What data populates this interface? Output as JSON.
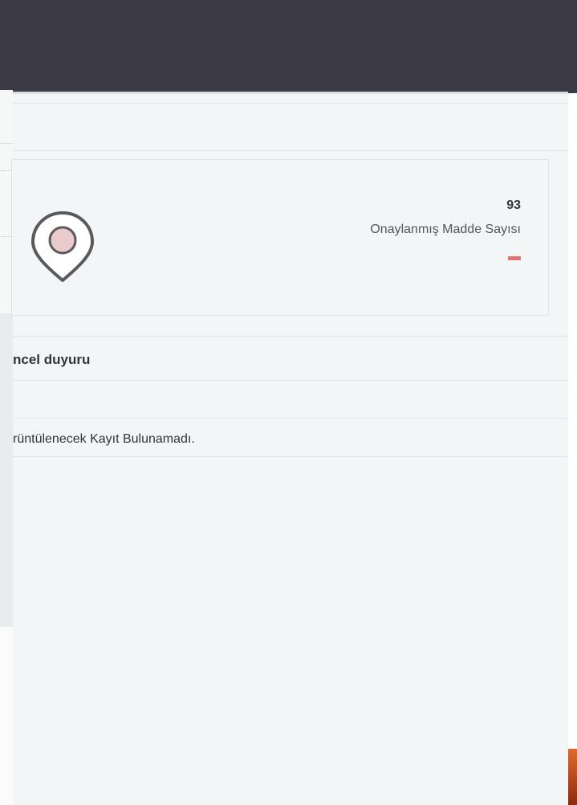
{
  "stat": {
    "value": "93",
    "label": "Onaylanmış Madde Sayısı",
    "icon": "map-marker-icon"
  },
  "announcements": {
    "title": "ncel duyuru",
    "empty_message": "rüntülenecek Kayıt Bulunamadı."
  },
  "colors": {
    "topbar": "#3b3a46",
    "panel_bg": "#f3f6f7",
    "accent_dash": "#e57373",
    "marker_fill": "#eacaca",
    "marker_stroke": "#5a5a5e"
  }
}
